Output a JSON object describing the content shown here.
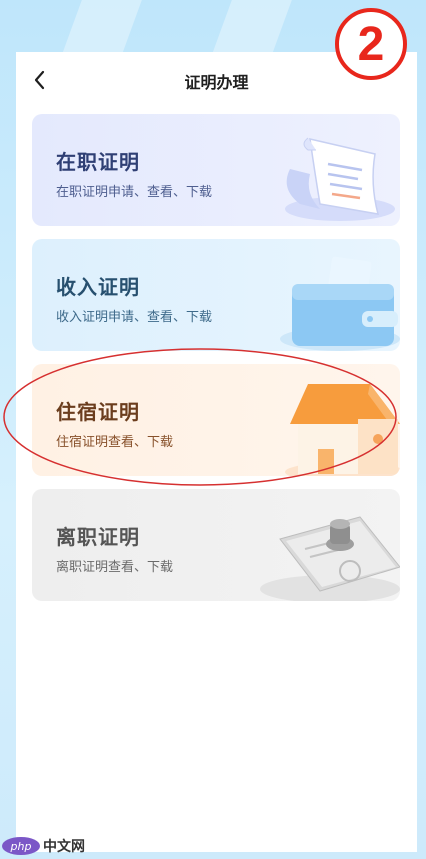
{
  "header": {
    "title": "证明办理",
    "back_icon": "chevron-left-icon"
  },
  "step_badge": {
    "label": "2",
    "color": "#e8271c"
  },
  "cards": [
    {
      "title": "在职证明",
      "subtitle": "在职证明申请、查看、下载",
      "icon": "document-scroll-icon",
      "accent": "#2f3f74"
    },
    {
      "title": "收入证明",
      "subtitle": "收入证明申请、查看、下载",
      "icon": "wallet-icon",
      "accent": "#27506f"
    },
    {
      "title": "住宿证明",
      "subtitle": "住宿证明查看、下载",
      "icon": "house-icon",
      "accent": "#6b3d1d"
    },
    {
      "title": "离职证明",
      "subtitle": "离职证明查看、下载",
      "icon": "stamp-icon",
      "accent": "#555555"
    }
  ],
  "highlight": {
    "target": "住宿证明",
    "color": "#d63030"
  },
  "watermark": {
    "logo": "php",
    "text": "中文网"
  }
}
